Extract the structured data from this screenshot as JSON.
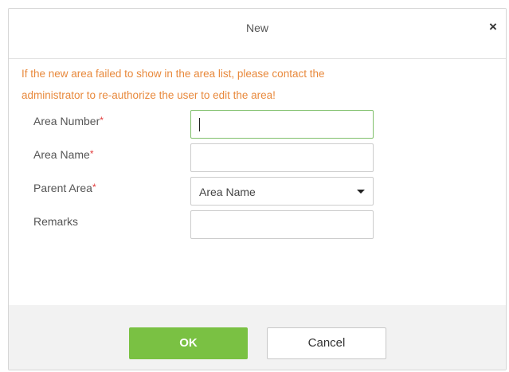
{
  "dialog": {
    "title": "New",
    "close_symbol": "×"
  },
  "warning": {
    "line1": "If the new area failed to show in the area list, please contact the",
    "line2": "administrator to re-authorize the user to edit the area!"
  },
  "form": {
    "area_number": {
      "label": "Area Number",
      "required_mark": "*",
      "value": ""
    },
    "area_name": {
      "label": "Area Name",
      "required_mark": "*",
      "value": ""
    },
    "parent_area": {
      "label": "Parent Area",
      "required_mark": "*",
      "selected": "Area Name"
    },
    "remarks": {
      "label": "Remarks",
      "value": ""
    }
  },
  "buttons": {
    "ok": "OK",
    "cancel": "Cancel"
  },
  "colors": {
    "warning": "#e8893c",
    "required": "#e23b3b",
    "ok_button": "#7ac143",
    "active_field_border": "#7fbf6a"
  }
}
